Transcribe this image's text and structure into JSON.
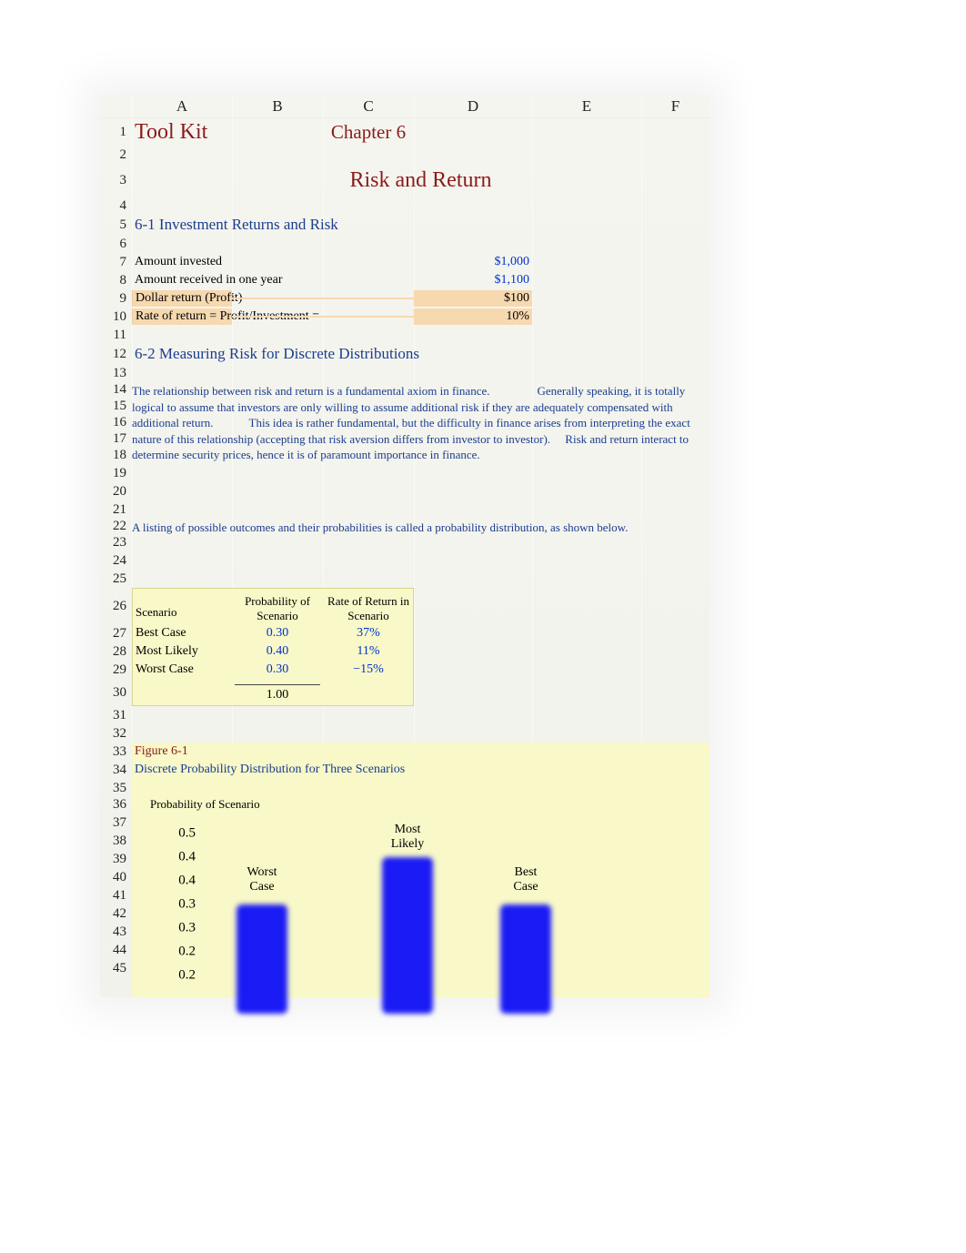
{
  "columns": [
    "A",
    "B",
    "C",
    "D",
    "E",
    "F"
  ],
  "rows_visible": [
    1,
    2,
    3,
    4,
    5,
    6,
    7,
    8,
    9,
    10,
    11,
    12,
    13,
    14,
    15,
    16,
    17,
    18,
    19,
    20,
    21,
    22,
    23,
    24,
    25,
    26,
    27,
    28,
    29,
    30,
    31,
    32,
    33,
    34,
    35,
    36,
    37,
    38,
    39,
    40,
    41,
    42,
    43,
    44,
    45
  ],
  "r1": {
    "title": "Tool Kit",
    "chapter": "Chapter 6"
  },
  "r3": {
    "heading": "Risk and Return"
  },
  "r5": {
    "section": "6-1 Investment Returns and Risk"
  },
  "r7": {
    "label": "Amount invested",
    "value": "$1,000"
  },
  "r8": {
    "label": "Amount received in one year",
    "value": "$1,100"
  },
  "r9": {
    "label": "Dollar return (Profit)",
    "value": "$100"
  },
  "r10": {
    "label": "Rate of return = Profit/Investment =",
    "value": "10%"
  },
  "r12": {
    "section": "6-2 Measuring Risk for Discrete Distributions"
  },
  "para1": "The relationship between risk and return is a fundamental axiom in finance.    Generally speaking, it is totally logical to assume that investors are only willing to assume additional risk if they are adequately compensated with additional return.   This idea is rather fundamental, but the difficulty in finance arises from interpreting the exact nature of this relationship (accepting that risk aversion differs from investor to investor).  Risk and return interact to determine security prices, hence it is of paramount importance in finance.",
  "para2": "A listing of possible outcomes and their probabilities is called a probability distribution, as shown below.",
  "prob_table": {
    "headers": {
      "scenario": "Scenario",
      "prob": "Probability of Scenario",
      "ror": "Rate of Return in Scenario"
    },
    "rows": [
      {
        "scenario": "Best Case",
        "prob": "0.30",
        "ror": "37%"
      },
      {
        "scenario": "Most Likely",
        "prob": "0.40",
        "ror": "11%"
      },
      {
        "scenario": "Worst Case",
        "prob": "0.30",
        "ror": "−15%"
      }
    ],
    "sum": "1.00"
  },
  "fig": {
    "label": "Figure 6-1",
    "title": "Discrete Probability Distribution for Three Scenarios",
    "ylabel": "Probability of Scenario"
  },
  "chart_data": {
    "type": "bar",
    "title": "Discrete Probability Distribution for Three Scenarios",
    "xlabel": "",
    "ylabel": "Probability of Scenario",
    "ylim": [
      0,
      0.5
    ],
    "y_ticks": [
      0.5,
      0.4,
      0.4,
      0.3,
      0.3,
      0.2,
      0.2
    ],
    "categories": [
      "Worst Case",
      "Most Likely",
      "Best Case"
    ],
    "values": [
      0.3,
      0.4,
      0.3
    ],
    "style": {
      "bar_color": "#1a1af5",
      "background": "#f8f8c8"
    }
  }
}
